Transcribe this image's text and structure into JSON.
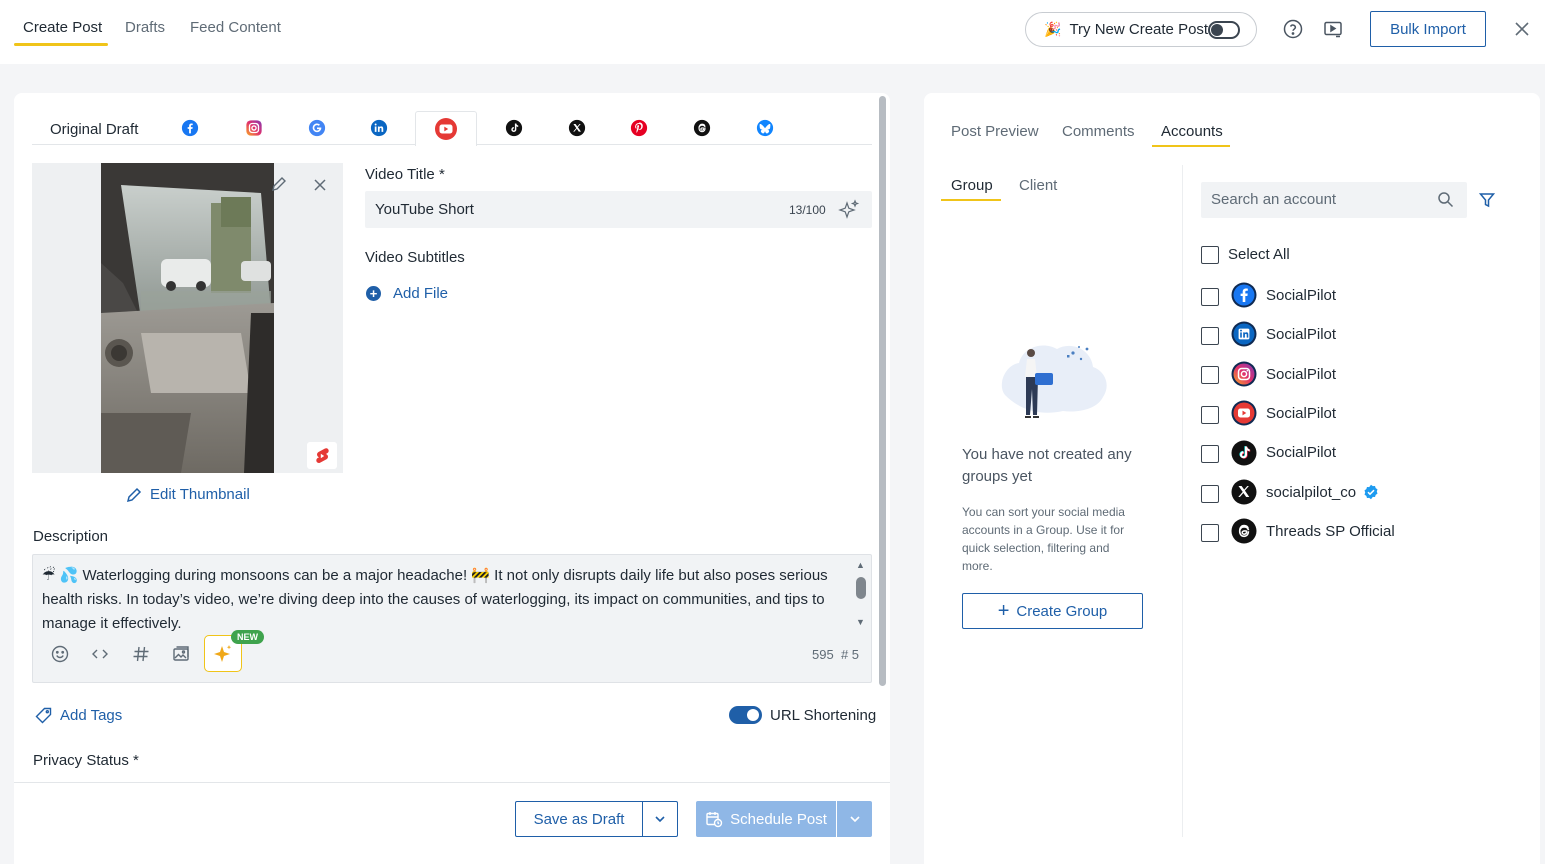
{
  "top_tabs": [
    {
      "label": "Create Post"
    },
    {
      "label": "Drafts"
    },
    {
      "label": "Feed Content"
    }
  ],
  "header": {
    "try_new_label": "Try New Create Post",
    "bulk_import_label": "Bulk Import"
  },
  "network_tabs": {
    "original_label": "Original Draft",
    "networks": [
      "facebook",
      "instagram",
      "google",
      "linkedin",
      "youtube",
      "tiktok",
      "x",
      "pinterest",
      "threads",
      "bluesky"
    ],
    "active": "youtube"
  },
  "media": {
    "edit_thumbnail_label": "Edit Thumbnail"
  },
  "youtube_fields": {
    "video_title_label": "Video Title *",
    "video_title_value": "YouTube Short",
    "video_title_count": "13/100",
    "video_subtitles_label": "Video Subtitles",
    "add_file_label": "Add File"
  },
  "description": {
    "label": "Description",
    "text": "☔ 💦 Waterlogging during monsoons can be a major headache! 🚧 It not only disrupts daily life but also poses serious health risks. In today’s video, we’re diving deep into the causes of waterlogging, its impact on communities, and tips to manage it effectively.",
    "new_badge": "NEW",
    "char_count": "595",
    "hashtag_count": "# 5"
  },
  "options": {
    "add_tags_label": "Add Tags",
    "url_shortening_label": "URL Shortening",
    "url_shortening_on": true,
    "privacy_status_label": "Privacy Status *"
  },
  "actions": {
    "save_draft_label": "Save as Draft",
    "schedule_label": "Schedule Post"
  },
  "right_tabs": [
    {
      "label": "Post Preview"
    },
    {
      "label": "Comments"
    },
    {
      "label": "Accounts"
    }
  ],
  "sub_tabs": [
    {
      "label": "Group"
    },
    {
      "label": "Client"
    }
  ],
  "groups_empty": {
    "title": "You have not created any groups yet",
    "description": "You can sort your social media accounts in a Group. Use it for quick selection, filtering and more.",
    "create_label": "Create Group"
  },
  "accounts": {
    "search_placeholder": "Search an account",
    "select_all_label": "Select All",
    "items": [
      {
        "network": "facebook",
        "name": "SocialPilot"
      },
      {
        "network": "linkedin",
        "name": "SocialPilot"
      },
      {
        "network": "instagram",
        "name": "SocialPilot"
      },
      {
        "network": "youtube",
        "name": "SocialPilot"
      },
      {
        "network": "tiktok",
        "name": "SocialPilot"
      },
      {
        "network": "x",
        "name": "socialpilot_co",
        "verified": true
      },
      {
        "network": "threads",
        "name": "Threads SP Official"
      }
    ]
  },
  "colors": {
    "accent_blue": "#1f5fa8",
    "tab_underline": "#f0c419",
    "schedule_disabled": "#8fb7e6"
  }
}
